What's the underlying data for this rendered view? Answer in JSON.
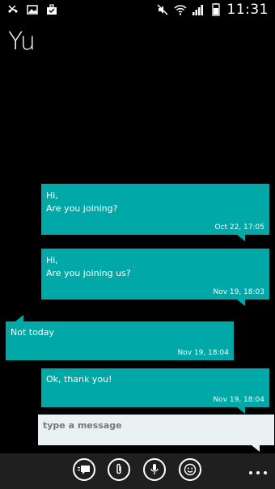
{
  "status": {
    "time": "11:31"
  },
  "contact": {
    "name": "Yu"
  },
  "messages": [
    {
      "direction": "out",
      "text": "Hi,\nAre you joining?",
      "time": "Oct 22, 17:05"
    },
    {
      "direction": "out",
      "text": "Hi,\nAre you joining us?",
      "time": "Nov 19, 18:03"
    },
    {
      "direction": "in",
      "text": "Not today",
      "time": "Nov 19, 18:04"
    },
    {
      "direction": "out",
      "text": "Ok, thank you!",
      "time": "Nov 19, 18:04"
    }
  ],
  "compose": {
    "placeholder": "type a message",
    "value": ""
  },
  "appbar": {
    "icons": [
      "chat-icon",
      "paperclip-icon",
      "microphone-icon",
      "smiley-icon"
    ],
    "more": "more-icon"
  },
  "colors": {
    "bubble": "#00a8a8",
    "background": "#000000",
    "input": "#eaf1f3",
    "appbar": "#1f1f1f"
  }
}
